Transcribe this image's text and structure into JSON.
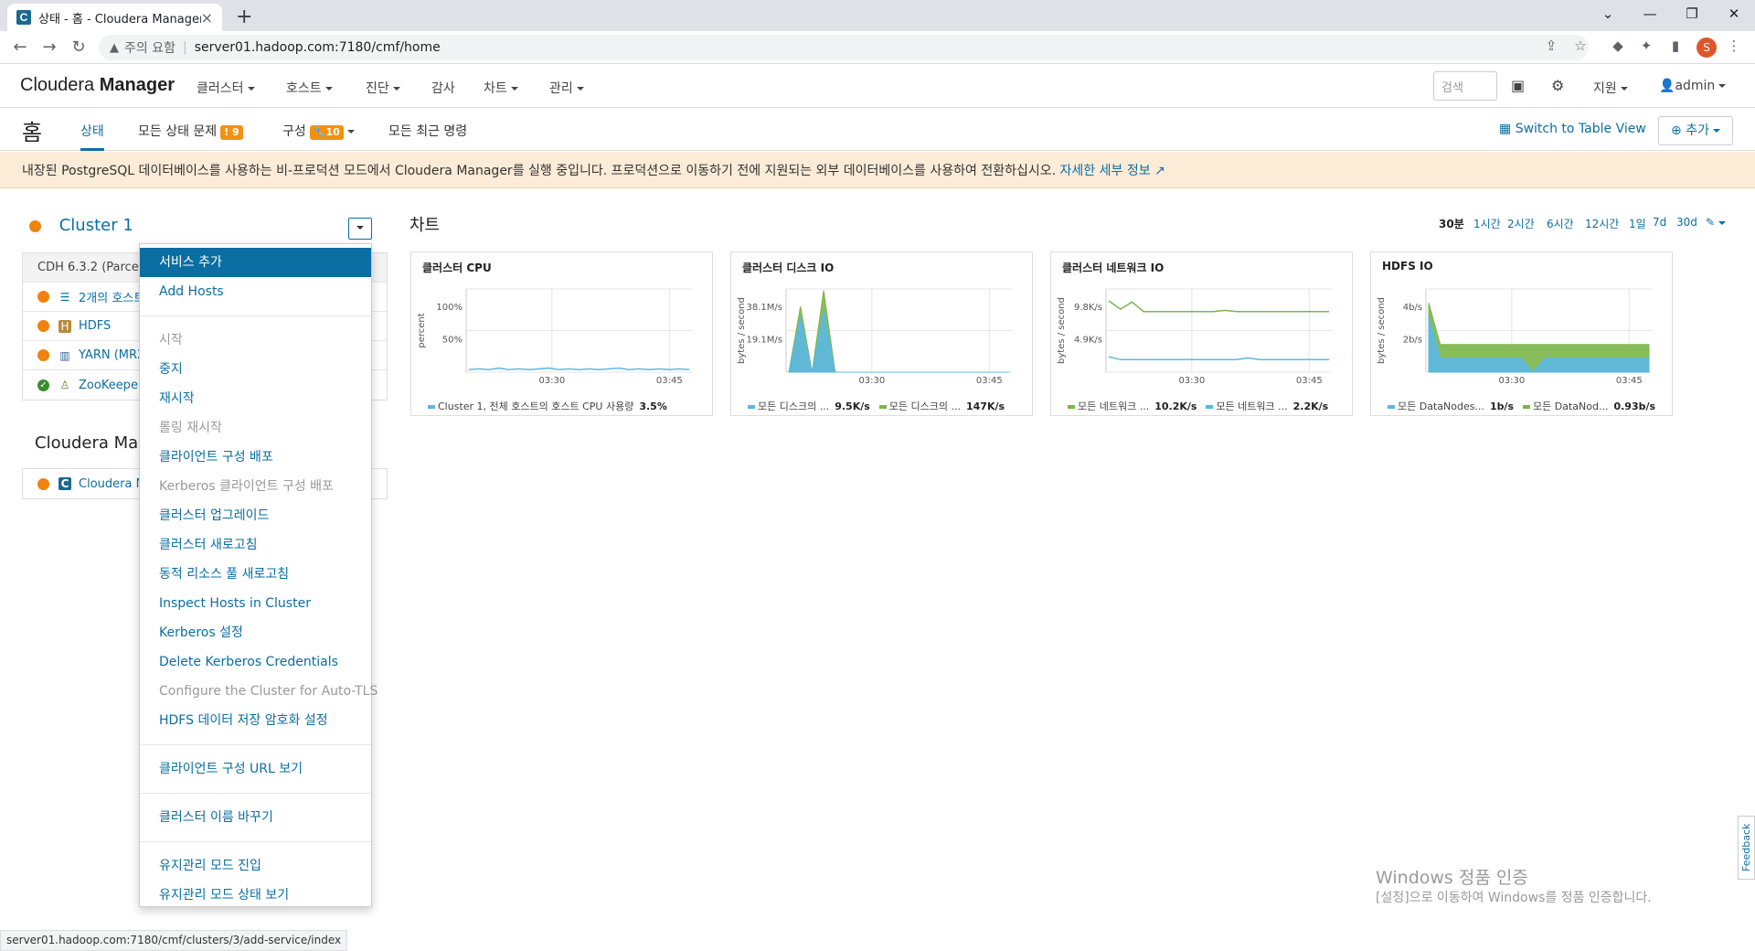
{
  "browser": {
    "tab_title": "상태 - 홈 - Cloudera Manager",
    "favicon_letter": "C",
    "security_label": "주의 요함",
    "url": "server01.hadoop.com:7180/cmf/home",
    "profile_letter": "S"
  },
  "header": {
    "logo_light": "Cloudera",
    "logo_bold": "Manager",
    "nav": [
      "클러스터",
      "호스트",
      "진단",
      "감사",
      "차트",
      "관리"
    ],
    "search_placeholder": "검색",
    "support": "지원",
    "user": "admin"
  },
  "subnav": {
    "home": "홈",
    "tabs": {
      "status": "상태",
      "issues": "모든 상태 문제",
      "issues_count": "9",
      "config": "구성",
      "config_count": "10",
      "commands": "모든 최근 명령"
    },
    "table_view": "Switch to Table View",
    "add": "추가"
  },
  "banner": {
    "text": "내장된 PostgreSQL 데이터베이스를 사용하는 비-프로덕션 모드에서 Cloudera Manager를 실행 중입니다. 프로덕션으로 이동하기 전에 지원되는 외부 데이터베이스를 사용하여 전환하십시오.",
    "link": "자세한 세부 정보"
  },
  "cluster": {
    "name": "Cluster 1",
    "version": "CDH 6.3.2 (Parcel)",
    "services": [
      {
        "name": "2개의 호스트",
        "icon": "list-icon",
        "status": "warning"
      },
      {
        "name": "HDFS",
        "icon": "hdfs-icon",
        "status": "warning"
      },
      {
        "name": "YARN (MR2",
        "icon": "yarn-icon",
        "status": "warning"
      },
      {
        "name": "ZooKeeper",
        "icon": "zookeeper-icon",
        "status": "good"
      }
    ]
  },
  "cm_section": {
    "title": "Cloudera Mana",
    "service": "Cloudera M"
  },
  "menu": {
    "items": [
      {
        "label": "서비스 추가",
        "state": "highlighted"
      },
      {
        "label": "Add Hosts",
        "state": "enabled"
      },
      {
        "divider": true
      },
      {
        "label": "시작",
        "state": "disabled"
      },
      {
        "label": "중지",
        "state": "enabled"
      },
      {
        "label": "재시작",
        "state": "enabled"
      },
      {
        "label": "롤링 재시작",
        "state": "disabled"
      },
      {
        "label": "클라이언트 구성 배포",
        "state": "enabled"
      },
      {
        "label": "Kerberos 클라이언트 구성 배포",
        "state": "disabled"
      },
      {
        "label": "클러스터 업그레이드",
        "state": "enabled"
      },
      {
        "label": "클러스터 새로고침",
        "state": "enabled"
      },
      {
        "label": "동적 리소스 풀 새로고침",
        "state": "enabled"
      },
      {
        "label": "Inspect Hosts in Cluster",
        "state": "enabled"
      },
      {
        "label": "Kerberos 설정",
        "state": "enabled"
      },
      {
        "label": "Delete Kerberos Credentials",
        "state": "enabled"
      },
      {
        "label": "Configure the Cluster for Auto-TLS",
        "state": "disabled"
      },
      {
        "label": "HDFS 데이터 저장 암호화 설정",
        "state": "enabled"
      },
      {
        "divider": true
      },
      {
        "label": "클라이언트 구성 URL 보기",
        "state": "enabled"
      },
      {
        "divider": true
      },
      {
        "label": "클러스터 이름 바꾸기",
        "state": "enabled"
      },
      {
        "divider": true
      },
      {
        "label": "유지관리 모드 진입",
        "state": "enabled"
      },
      {
        "label": "유지관리 모드 상태 보기",
        "state": "enabled"
      }
    ]
  },
  "charts_section": {
    "title": "차트",
    "ranges": [
      "30분",
      "1시간",
      "2시간",
      "6시간",
      "12시간",
      "1일",
      "7d",
      "30d"
    ],
    "selected_range": "30분"
  },
  "chart_data": [
    {
      "type": "line",
      "title": "클러스터 CPU",
      "ylabel": "percent",
      "yticks": [
        "100%",
        "50%"
      ],
      "ylim": [
        0,
        100
      ],
      "xticks": [
        "03:30",
        "03:45"
      ],
      "series": [
        {
          "name": "Cluster 1, 전체 호스트의 호스트 CPU 사용량",
          "value_label": "3.5%",
          "color": "#5bb8e3",
          "values": [
            3,
            4,
            3,
            5,
            3,
            4,
            3,
            4,
            5,
            3,
            4,
            3,
            4,
            3,
            4,
            5,
            3,
            4,
            3,
            4,
            3,
            4,
            3
          ]
        }
      ]
    },
    {
      "type": "area",
      "title": "클러스터 디스크 IO",
      "ylabel": "bytes / second",
      "yticks": [
        "38.1M/s",
        "19.1M/s"
      ],
      "ylim": [
        0,
        57
      ],
      "xticks": [
        "03:30",
        "03:45"
      ],
      "series": [
        {
          "name": "모든 디스크의 ...",
          "value_label": "147K/s",
          "color": "#7ab648",
          "values": [
            0,
            45,
            0,
            56,
            0,
            0,
            0,
            0,
            0,
            0,
            0,
            0,
            0,
            0,
            0,
            0,
            0,
            0,
            0,
            0
          ]
        },
        {
          "name": "모든 디스크의 ...",
          "value_label": "9.5K/s",
          "color": "#5bb8e3",
          "values": [
            0,
            38,
            0,
            42,
            0,
            0,
            0,
            0,
            0,
            0,
            0,
            0,
            0,
            0,
            0,
            0,
            0,
            0,
            0,
            0
          ]
        }
      ]
    },
    {
      "type": "line",
      "title": "클러스터 네트워크 IO",
      "ylabel": "bytes / second",
      "yticks": [
        "9.8K/s",
        "4.9K/s"
      ],
      "ylim": [
        0,
        14
      ],
      "xticks": [
        "03:30",
        "03:45"
      ],
      "series": [
        {
          "name": "모든 네트워크 ...",
          "value_label": "2.2K/s",
          "color": "#5bb8e3",
          "values": [
            2.6,
            2.1,
            2.1,
            2.1,
            2.1,
            2.1,
            2.1,
            2.1,
            2.1,
            2.1,
            2.1,
            2.1,
            2.4,
            2.1,
            2.1,
            2.1,
            2.1,
            2.1,
            2.1,
            2.1
          ]
        },
        {
          "name": "모든 네트워크 ...",
          "value_label": "10.2K/s",
          "color": "#7ab648",
          "values": [
            12.0,
            10.6,
            11.8,
            10.2,
            10.2,
            10.2,
            10.2,
            10.2,
            10.2,
            10.2,
            10.4,
            10.2,
            10.2,
            10.2,
            10.2,
            10.2,
            10.2,
            10.2,
            10.2,
            10.2
          ]
        }
      ]
    },
    {
      "type": "area",
      "title": "HDFS IO",
      "ylabel": "bytes / second",
      "yticks": [
        "4b/s",
        "2b/s"
      ],
      "ylim": [
        0,
        6
      ],
      "xticks": [
        "03:30",
        "03:45"
      ],
      "series": [
        {
          "name": "모든 DataNod...",
          "value_label": "0.93b/s",
          "color": "#7ab648",
          "values": [
            5,
            2,
            2,
            2,
            2,
            2,
            2,
            2,
            2,
            2,
            2,
            2,
            2,
            2,
            2,
            2,
            2,
            2,
            2,
            2
          ]
        },
        {
          "name": "모든 DataNodes...",
          "value_label": "1b/s",
          "color": "#5bb8e3",
          "values": [
            4,
            1,
            1,
            1,
            1,
            1,
            1,
            1,
            1,
            0,
            1,
            1,
            1,
            1,
            1,
            1,
            1,
            1,
            1,
            1
          ]
        }
      ]
    }
  ],
  "status_url": "server01.hadoop.com:7180/cmf/clusters/3/add-service/index",
  "watermark": {
    "line1": "Windows 정품 인증",
    "line2": "[설정]으로 이동하여 Windows를 정품 인증합니다."
  },
  "feedback": "Feedback",
  "colors": {
    "accent": "#0a6ea3",
    "warning": "#f0820f",
    "good": "#3a8d2f",
    "banner_bg": "#fcebd6"
  }
}
